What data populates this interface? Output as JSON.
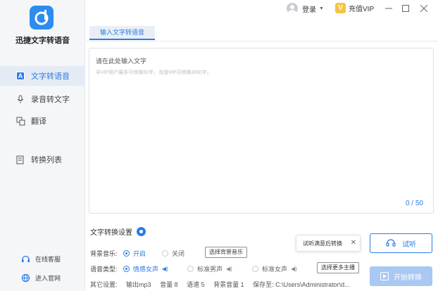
{
  "app": {
    "name": "迅捷文字转语音"
  },
  "sidebar": {
    "items": [
      {
        "label": "文字转语音",
        "icon": "text-to-speech-icon",
        "active": true
      },
      {
        "label": "录音转文字",
        "icon": "microphone-icon",
        "active": false
      },
      {
        "label": "翻译",
        "icon": "translate-icon",
        "active": false
      },
      {
        "label": "转换列表",
        "icon": "list-icon",
        "active": false
      }
    ],
    "bottom_links": [
      {
        "label": "在线客服",
        "icon": "support-icon"
      },
      {
        "label": "进入官网",
        "icon": "globe-icon"
      }
    ]
  },
  "header": {
    "login_label": "登录",
    "vip_label": "充值VIP",
    "vip_badge": "V"
  },
  "tab": {
    "label": "输入文字转语音"
  },
  "editor": {
    "placeholder": "请在此处输入文字",
    "hint": "非VIP用户最多可转换50字，充值VIP可转换3000字。",
    "count": "0 / 50"
  },
  "settings": {
    "title": "文字转换设置",
    "bg_music": {
      "label": "背景音乐:",
      "on_label": "开启",
      "off_label": "关闭",
      "button_label": "选择背景音乐"
    },
    "voice_type": {
      "label": "语音类型:",
      "options": [
        "情感女声",
        "标准男声",
        "标准女声"
      ],
      "selected": "情感女声",
      "button_label": "选择更多主播"
    },
    "other": {
      "label": "其它设置:",
      "output": "输出mp3",
      "volume": "音量 8",
      "speed": "语速 5",
      "bg_volume": "背景音量 1",
      "save_path": "保存至: C:\\Users\\Administrator\\d..."
    }
  },
  "actions": {
    "tooltip": "试听满意后转换",
    "listen_label": "试听",
    "start_label": "开始转换"
  },
  "colors": {
    "accent": "#2c7be5",
    "sidebar_bg": "#f5f6f8",
    "vip": "#f5c542",
    "start_disabled": "#a9c8f2"
  }
}
